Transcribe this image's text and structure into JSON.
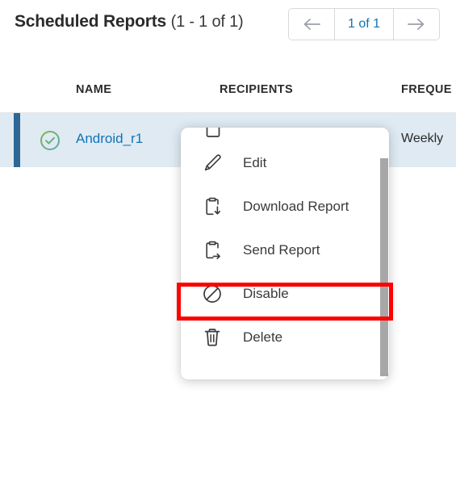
{
  "header": {
    "title": "Scheduled Reports",
    "count": "(1 - 1 of 1)"
  },
  "pagination": {
    "prev_icon": "arrow-left-icon",
    "label": "1 of 1",
    "next_icon": "arrow-right-icon"
  },
  "table": {
    "columns": [
      {
        "key": "name",
        "label": "NAME"
      },
      {
        "key": "recipients",
        "label": "RECIPIENTS"
      },
      {
        "key": "frequency",
        "label": "FREQUE"
      }
    ],
    "rows": [
      {
        "status_icon": "check-circle-icon",
        "name": "Android_r1",
        "recipients": "",
        "frequency": "Weekly",
        "selected": true
      }
    ]
  },
  "context_menu": {
    "clipped_top_icon": "clipboard-icon",
    "items": [
      {
        "icon": "pencil-icon",
        "label": "Edit",
        "highlighted": false
      },
      {
        "icon": "clipboard-download-icon",
        "label": "Download Report",
        "highlighted": false
      },
      {
        "icon": "clipboard-send-icon",
        "label": "Send Report",
        "highlighted": false
      },
      {
        "icon": "circle-slash-icon",
        "label": "Disable",
        "highlighted": true
      },
      {
        "icon": "trash-icon",
        "label": "Delete",
        "highlighted": false
      }
    ],
    "scrollbar_visible": true
  },
  "colors": {
    "link": "#1273b7",
    "row_selected_bg": "#dfeaf2",
    "row_accent": "#2e6795",
    "status_ok": "#6cb33f",
    "highlight_outline": "#ff0000",
    "scrollbar": "#a7a7a7"
  }
}
